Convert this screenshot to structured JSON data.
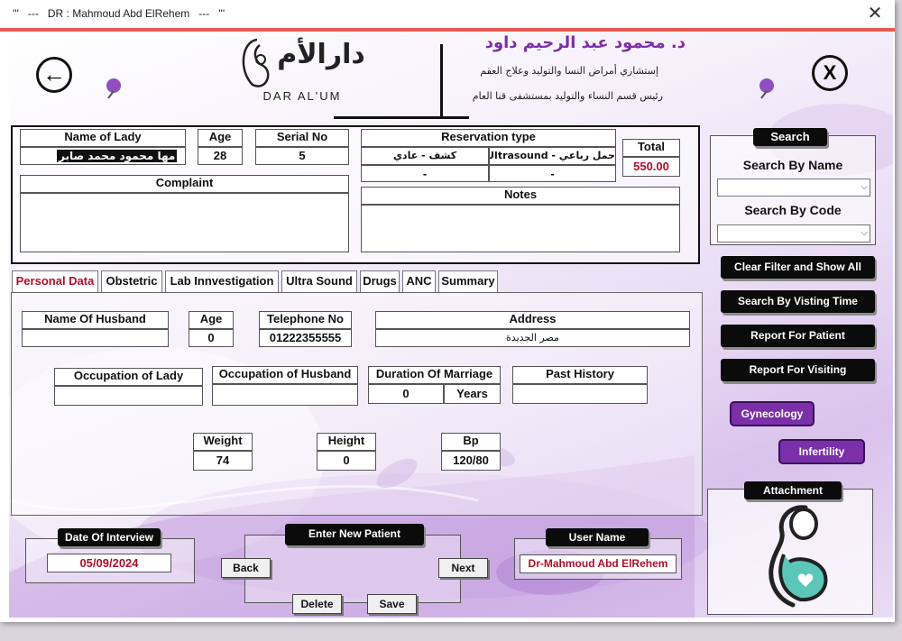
{
  "window": {
    "title": "'''   ---   DR : Mahmoud Abd ElRehem   ---   '''",
    "close_glyph": "✕"
  },
  "header": {
    "back_glyph": "←",
    "close_glyph": "X",
    "logo_arabic": "دارالأم",
    "logo_latin": "DAR  AL'UM",
    "doctor_name_ar": "د. محمود عبد الرحيم داود",
    "doctor_line1_ar": "إستشاري أمراض النسا والتوليد وعلاج العقم",
    "doctor_line2_ar": "رئيس قسم النساء والتوليد بمستشفى قنا العام"
  },
  "patient": {
    "name_label": "Name of Lady",
    "name_value": "مها محمود محمد صابر",
    "age_label": "Age",
    "age_value": "28",
    "serial_label": "Serial No",
    "serial_value": "5",
    "complaint_label": "Complaint"
  },
  "reservation": {
    "label": "Reservation type",
    "cells": [
      "حمل رباعي - Ultrasound",
      "كشف - عادي",
      "-",
      "-"
    ],
    "total_label": "Total",
    "total_value": "550.00",
    "notes_label": "Notes"
  },
  "tabs": [
    "Personal Data",
    "Obstetric",
    "Lab Innvestigation",
    "Ultra Sound",
    "Drugs",
    "ANC",
    "Summary"
  ],
  "personal": {
    "husband_label": "Name Of Husband",
    "husband_value": "",
    "age_label": "Age",
    "age_value": "0",
    "phone_label": "Telephone No",
    "phone_value": "01222355555",
    "address_label": "Address",
    "address_value": "مصر الجديدة",
    "occ_lady_label": "Occupation of Lady",
    "occ_husband_label": "Occupation of Husband",
    "duration_label": "Duration Of Marriage",
    "duration_value": "0",
    "duration_unit": "Years",
    "past_history_label": "Past History",
    "weight_label": "Weight",
    "weight_value": "74",
    "height_label": "Height",
    "height_value": "0",
    "bp_label": "Bp",
    "bp_value": "120/80"
  },
  "search": {
    "title": "Search",
    "by_name": "Search By Name",
    "by_code": "Search By Code",
    "arrow": "⌵"
  },
  "actions": {
    "clear_filter": "Clear Filter and Show All",
    "by_time": "Search By Visting Time",
    "report_patient": "Report For Patient",
    "report_visiting": "Report For Visiting",
    "gynecology": "Gynecology",
    "infertility": "Infertility",
    "attachment": "Attachment"
  },
  "footer": {
    "date_label": "Date Of Interview",
    "date_value": "05/09/2024",
    "new_patient": "Enter New Patient",
    "back": "Back",
    "next": "Next",
    "delete": "Delete",
    "save": "Save",
    "user_label": "User Name",
    "user_value": "Dr-Mahmoud Abd ElRehem"
  },
  "colors": {
    "accent_red": "#e65a4f",
    "value_red": "#b0102a",
    "button_purple": "#7b2fa8",
    "button_dark": "#0b0b0b"
  }
}
